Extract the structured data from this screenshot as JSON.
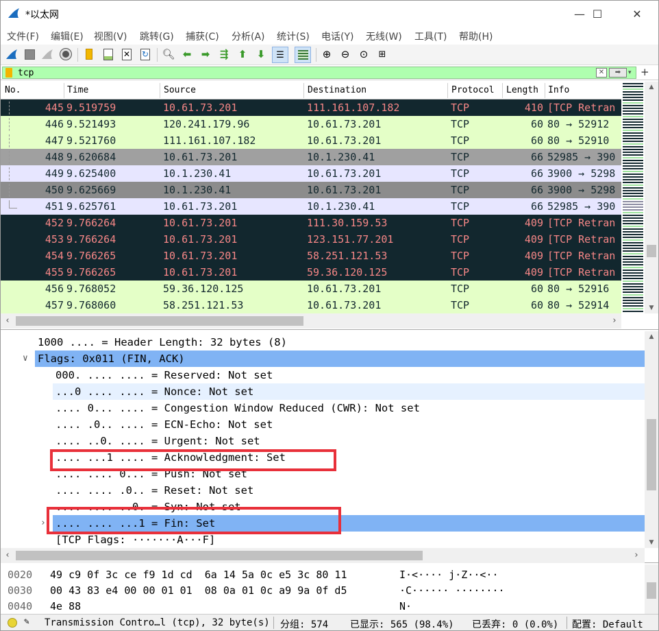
{
  "window": {
    "title": "*以太网",
    "minimize_glyph": "—",
    "maximize_glyph": "☐",
    "close_glyph": "✕"
  },
  "menu": [
    "文件(F)",
    "编辑(E)",
    "视图(V)",
    "跳转(G)",
    "捕获(C)",
    "分析(A)",
    "统计(S)",
    "电话(Y)",
    "无线(W)",
    "工具(T)",
    "帮助(H)"
  ],
  "toolbar": {
    "icons": [
      "shark-fin-start-icon",
      "stop-icon",
      "restart-icon",
      "capture-options-icon",
      "open-file-icon",
      "save-file-icon",
      "close-file-icon",
      "reload-icon",
      "find-packet-icon",
      "go-back-icon",
      "go-forward-icon",
      "go-to-packet-icon",
      "go-first-icon",
      "go-last-icon",
      "autoscroll-icon",
      "colorize-icon",
      "zoom-in-icon",
      "zoom-out-icon",
      "zoom-normal-icon",
      "resize-columns-icon"
    ]
  },
  "filter": {
    "value": "tcp",
    "clear_glyph": "✕",
    "apply_glyph": "➡",
    "dropdown_glyph": "▾",
    "add_glyph": "+"
  },
  "packet_list": {
    "columns": [
      "No.",
      "Time",
      "Source",
      "Destination",
      "Protocol",
      "Length",
      "Info"
    ],
    "rows": [
      {
        "no": "445",
        "time": "9.519759",
        "src": "10.61.73.201",
        "dst": "111.161.107.182",
        "proto": "TCP",
        "len": "410",
        "info": "[TCP Retran",
        "bg": "#12272e",
        "fg": "#f78787",
        "rel": "line"
      },
      {
        "no": "446",
        "time": "9.521493",
        "src": "120.241.179.96",
        "dst": "10.61.73.201",
        "proto": "TCP",
        "len": "60",
        "info": "80 → 52912",
        "bg": "#e4ffc7",
        "fg": "#12272e",
        "rel": "line"
      },
      {
        "no": "447",
        "time": "9.521760",
        "src": "111.161.107.182",
        "dst": "10.61.73.201",
        "proto": "TCP",
        "len": "60",
        "info": "80 → 52910",
        "bg": "#e4ffc7",
        "fg": "#12272e",
        "rel": "line"
      },
      {
        "no": "448",
        "time": "9.620684",
        "src": "10.61.73.201",
        "dst": "10.1.230.41",
        "proto": "TCP",
        "len": "66",
        "info": "52985 → 390",
        "bg": "#a0a0a0",
        "fg": "#12272e",
        "rel": "line"
      },
      {
        "no": "449",
        "time": "9.625400",
        "src": "10.1.230.41",
        "dst": "10.61.73.201",
        "proto": "TCP",
        "len": "66",
        "info": "3900 → 5298",
        "bg": "#e7e6ff",
        "fg": "#12272e",
        "rel": "line"
      },
      {
        "no": "450",
        "time": "9.625669",
        "src": "10.1.230.41",
        "dst": "10.61.73.201",
        "proto": "TCP",
        "len": "66",
        "info": "3900 → 5298",
        "bg": "#8c8c8c",
        "fg": "#12272e",
        "rel": "line"
      },
      {
        "no": "451",
        "time": "9.625761",
        "src": "10.61.73.201",
        "dst": "10.1.230.41",
        "proto": "TCP",
        "len": "66",
        "info": "52985 → 390",
        "bg": "#e7e6ff",
        "fg": "#12272e",
        "rel": "end"
      },
      {
        "no": "452",
        "time": "9.766264",
        "src": "10.61.73.201",
        "dst": "111.30.159.53",
        "proto": "TCP",
        "len": "409",
        "info": "[TCP Retran",
        "bg": "#12272e",
        "fg": "#f78787",
        "rel": ""
      },
      {
        "no": "453",
        "time": "9.766264",
        "src": "10.61.73.201",
        "dst": "123.151.77.201",
        "proto": "TCP",
        "len": "409",
        "info": "[TCP Retran",
        "bg": "#12272e",
        "fg": "#f78787",
        "rel": ""
      },
      {
        "no": "454",
        "time": "9.766265",
        "src": "10.61.73.201",
        "dst": "58.251.121.53",
        "proto": "TCP",
        "len": "409",
        "info": "[TCP Retran",
        "bg": "#12272e",
        "fg": "#f78787",
        "rel": ""
      },
      {
        "no": "455",
        "time": "9.766265",
        "src": "10.61.73.201",
        "dst": "59.36.120.125",
        "proto": "TCP",
        "len": "409",
        "info": "[TCP Retran",
        "bg": "#12272e",
        "fg": "#f78787",
        "rel": ""
      },
      {
        "no": "456",
        "time": "9.768052",
        "src": "59.36.120.125",
        "dst": "10.61.73.201",
        "proto": "TCP",
        "len": "60",
        "info": "80 → 52916",
        "bg": "#e4ffc7",
        "fg": "#12272e",
        "rel": ""
      },
      {
        "no": "457",
        "time": "9.768060",
        "src": "58.251.121.53",
        "dst": "10.61.73.201",
        "proto": "TCP",
        "len": "60",
        "info": "80 → 52914",
        "bg": "#e4ffc7",
        "fg": "#12272e",
        "rel": ""
      }
    ]
  },
  "details": {
    "rows": [
      {
        "indent": 54,
        "text": "1000 .... = Header Length: 32 bytes (8)",
        "toggle": "",
        "bg": ""
      },
      {
        "indent": 54,
        "text": "Flags: 0x011 (FIN, ACK)",
        "toggle": "∨",
        "bg": "#80b3f4"
      },
      {
        "indent": 80,
        "text": "000. .... .... = Reserved: Not set",
        "toggle": "",
        "bg": ""
      },
      {
        "indent": 80,
        "text": "...0 .... .... = Nonce: Not set",
        "toggle": "",
        "bg": "#e6f1ff"
      },
      {
        "indent": 80,
        "text": ".... 0... .... = Congestion Window Reduced (CWR): Not set",
        "toggle": "",
        "bg": ""
      },
      {
        "indent": 80,
        "text": ".... .0.. .... = ECN-Echo: Not set",
        "toggle": "",
        "bg": ""
      },
      {
        "indent": 80,
        "text": ".... ..0. .... = Urgent: Not set",
        "toggle": "",
        "bg": ""
      },
      {
        "indent": 80,
        "text": ".... ...1 .... = Acknowledgment: Set",
        "toggle": "",
        "bg": ""
      },
      {
        "indent": 80,
        "text": ".... .... 0... = Push: Not set",
        "toggle": "",
        "bg": ""
      },
      {
        "indent": 80,
        "text": ".... .... .0.. = Reset: Not set",
        "toggle": "",
        "bg": ""
      },
      {
        "indent": 80,
        "text": ".... .... ..0. = Syn: Not set",
        "toggle": "",
        "bg": ""
      },
      {
        "indent": 80,
        "text": ".... .... ...1 = Fin: Set",
        "toggle": "›",
        "bg": "#80b3f4"
      },
      {
        "indent": 80,
        "text": "[TCP Flags: ·······A···F]",
        "toggle": "",
        "bg": ""
      }
    ]
  },
  "bytes": {
    "rows": [
      {
        "offset": "0020",
        "hex": "49 c9 0f 3c ce f9 1d cd  6a 14 5a 0c e5 3c 80 11",
        "ascii": "I·<···· j·Z··<··"
      },
      {
        "offset": "0030",
        "hex": "00 43 83 e4 00 00 01 01  08 0a 01 0c a9 9a 0f d5",
        "ascii": "·C······ ········"
      },
      {
        "offset": "0040",
        "hex": "4e 88",
        "ascii": "N·"
      }
    ]
  },
  "status": {
    "summary": "Transmission Contro…l (tcp), 32 byte(s)",
    "packets": "分组: 574",
    "displayed": "已显示: 565 (98.4%)",
    "dropped": "已丢弃: 0 (0.0%)",
    "profile": "配置: Default"
  }
}
